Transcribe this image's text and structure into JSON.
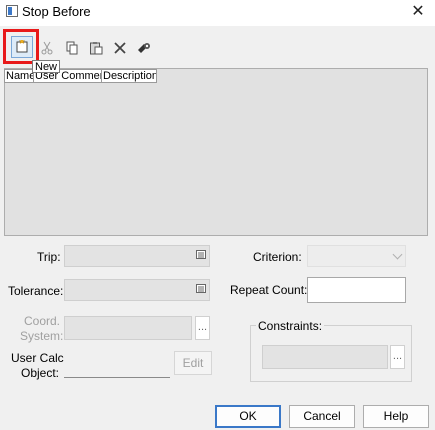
{
  "window": {
    "title": "Stop Before",
    "close_glyph": "✕"
  },
  "toolbar": {
    "buttons": [
      {
        "name": "new",
        "icon": "new-icon"
      },
      {
        "name": "cut",
        "icon": "scissors-icon"
      },
      {
        "name": "copy",
        "icon": "copy-icon"
      },
      {
        "name": "paste",
        "icon": "paste-icon"
      },
      {
        "name": "delete",
        "icon": "delete-x-icon"
      },
      {
        "name": "rename",
        "icon": "rename-icon"
      }
    ],
    "tooltip": "New",
    "highlight_color": "#e8191a"
  },
  "table": {
    "columns": [
      "Name",
      "User Comment",
      "Description"
    ],
    "rows": []
  },
  "form": {
    "trip_label": "Trip:",
    "tolerance_label": "Tolerance:",
    "coord_system_label_1": "Coord.",
    "coord_system_label_2": "System:",
    "coord_system_dots": "...",
    "user_calc_label_1": "User Calc",
    "user_calc_label_2": "Object:",
    "edit_label": "Edit",
    "criterion_label": "Criterion:",
    "repeat_count_label": "Repeat Count:",
    "repeat_count_value": "",
    "constraints_label": "Constraints:",
    "constraints_dots": "..."
  },
  "buttons": {
    "ok": "OK",
    "cancel": "Cancel",
    "help": "Help"
  },
  "colors": {
    "accent": "#3a78c8",
    "disabled_text": "#a0a0a0"
  }
}
